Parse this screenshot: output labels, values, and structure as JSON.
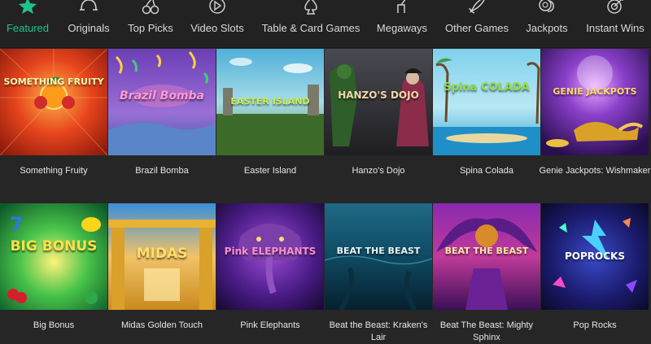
{
  "nav": {
    "items": [
      {
        "label": "Featured",
        "icon": "star-icon",
        "active": true
      },
      {
        "label": "Originals",
        "icon": "horseshoe-icon"
      },
      {
        "label": "Top Picks",
        "icon": "cherries-icon"
      },
      {
        "label": "Video Slots",
        "icon": "play-icon"
      },
      {
        "label": "Table & Card Games",
        "icon": "spade-icon"
      },
      {
        "label": "Megaways",
        "icon": "lever-icon"
      },
      {
        "label": "Other Games",
        "icon": "rocket-icon"
      },
      {
        "label": "Jackpots",
        "icon": "coins-icon"
      },
      {
        "label": "Instant Wins",
        "icon": "target-icon"
      }
    ],
    "active_color": "#21c28a"
  },
  "games": {
    "row1": [
      {
        "title": "Something Fruity",
        "logo": "SOMETHING FRUITY"
      },
      {
        "title": "Brazil Bomba",
        "logo": "Brazil Bomba"
      },
      {
        "title": "Easter Island",
        "logo": "EASTER ISLAND"
      },
      {
        "title": "Hanzo's Dojo",
        "logo": "HANZO'S DOJO"
      },
      {
        "title": "Spina Colada",
        "logo": "Spina COLADA"
      },
      {
        "title": "Genie Jackpots: Wishmaker",
        "logo": "GENIE JACKPOTS"
      }
    ],
    "row2": [
      {
        "title": "Big Bonus",
        "logo": "BIG BONUS"
      },
      {
        "title": "Midas Golden Touch",
        "logo": "MIDAS"
      },
      {
        "title": "Pink Elephants",
        "logo": "Pink ELEPHANTS"
      },
      {
        "title": "Beat the Beast: Kraken's Lair",
        "logo": "BEAT THE BEAST"
      },
      {
        "title": "Beat The Beast: Mighty Sphinx",
        "logo": "BEAT THE BEAST"
      },
      {
        "title": "Pop Rocks",
        "logo": "POPROCKS"
      }
    ]
  }
}
